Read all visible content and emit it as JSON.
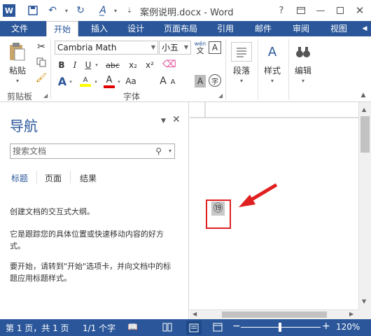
{
  "title": "案例说明.docx - Word",
  "tabs": [
    {
      "label": "文件"
    },
    {
      "label": "开始"
    },
    {
      "label": "插入"
    },
    {
      "label": "设计"
    },
    {
      "label": "页面布局"
    },
    {
      "label": "引用"
    },
    {
      "label": "邮件"
    },
    {
      "label": "审阅"
    },
    {
      "label": "视图"
    }
  ],
  "ribbon": {
    "clipboard_label": "剪贴板",
    "paste_label": "粘贴",
    "font_group_label": "字体",
    "font_name": "Cambria Math",
    "font_size": "小五",
    "paragraph_label": "段落",
    "styles_label": "样式",
    "editing_label": "编辑",
    "bold": "B",
    "italic": "I",
    "underline": "U",
    "strike": "abc",
    "subscript": "x₂",
    "superscript": "x²",
    "font_color_a": "A",
    "grow": "A",
    "shrink": "A",
    "aa": "Aa",
    "highlight_a": "A",
    "wen_label": "wén",
    "wen_char": "文",
    "char_border": "A",
    "char_shade": "A",
    "enclose": "字"
  },
  "nav": {
    "title": "导航",
    "search_placeholder": "搜索文档",
    "tabs": [
      "标题",
      "页面",
      "结果"
    ],
    "text1": "创建文档的交互式大纲。",
    "text2": "它是跟踪您的具体位置或快速移动内容的好方式。",
    "text3": "要开始，请转到\"开始\"选项卡，并向文档中的标题应用标题样式。"
  },
  "doc": {
    "enclosed_number": "⑲"
  },
  "status": {
    "page": "第 1 页，共 1 页",
    "words": "1/1 个字",
    "zoom": "120%"
  },
  "colors": {
    "brand": "#2b579a",
    "annotation_red": "#e02020",
    "highlight_yellow": "#ffff00",
    "font_red": "#e00000"
  }
}
